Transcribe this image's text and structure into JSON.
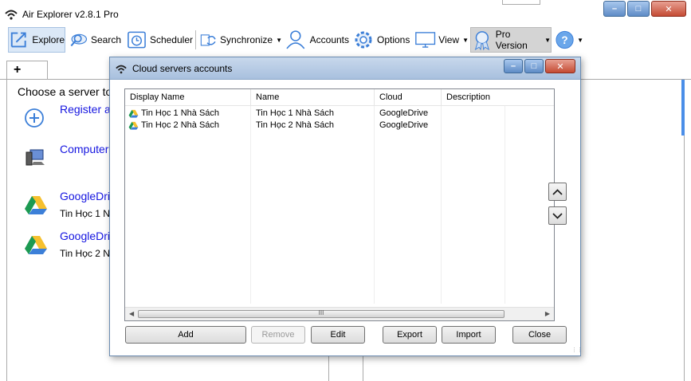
{
  "window": {
    "title": "Air Explorer v2.8.1 Pro"
  },
  "toolbar": {
    "explore": "Explore",
    "search": "Search",
    "scheduler": "Scheduler",
    "synchronize": "Synchronize",
    "accounts": "Accounts",
    "options": "Options",
    "view": "View",
    "pro_version": "Pro Version"
  },
  "tabs": {
    "add_tab": "+"
  },
  "left_pane": {
    "prompt": "Choose a server to",
    "servers": [
      {
        "name": "Register a",
        "sub": "",
        "icon": "plus-circle-icon"
      },
      {
        "name": "Computer",
        "sub": "",
        "icon": "computer-icon"
      },
      {
        "name": "GoogleDri",
        "sub": "Tin Học 1 N",
        "icon": "google-drive-icon"
      },
      {
        "name": "GoogleDri",
        "sub": "Tin Học 2 N",
        "icon": "google-drive-icon"
      }
    ]
  },
  "dialog": {
    "title": "Cloud servers accounts",
    "columns": [
      "Display Name",
      "Name",
      "Cloud",
      "Description"
    ],
    "rows": [
      {
        "display_name": "Tin Học 1 Nhà Sách",
        "name": "Tin Học 1 Nhà Sách",
        "cloud": "GoogleDrive",
        "description": ""
      },
      {
        "display_name": "Tin Học 2 Nhà Sách",
        "name": "Tin Học 2 Nhà Sách",
        "cloud": "GoogleDrive",
        "description": ""
      }
    ],
    "buttons": {
      "add": "Add",
      "remove": "Remove",
      "edit": "Edit",
      "export": "Export",
      "import": "Import",
      "close": "Close"
    },
    "scroll_thumb_label": "III"
  },
  "colors": {
    "link": "#1515e0",
    "accent": "#3c7fd8",
    "selection": "#dbe8f7"
  }
}
